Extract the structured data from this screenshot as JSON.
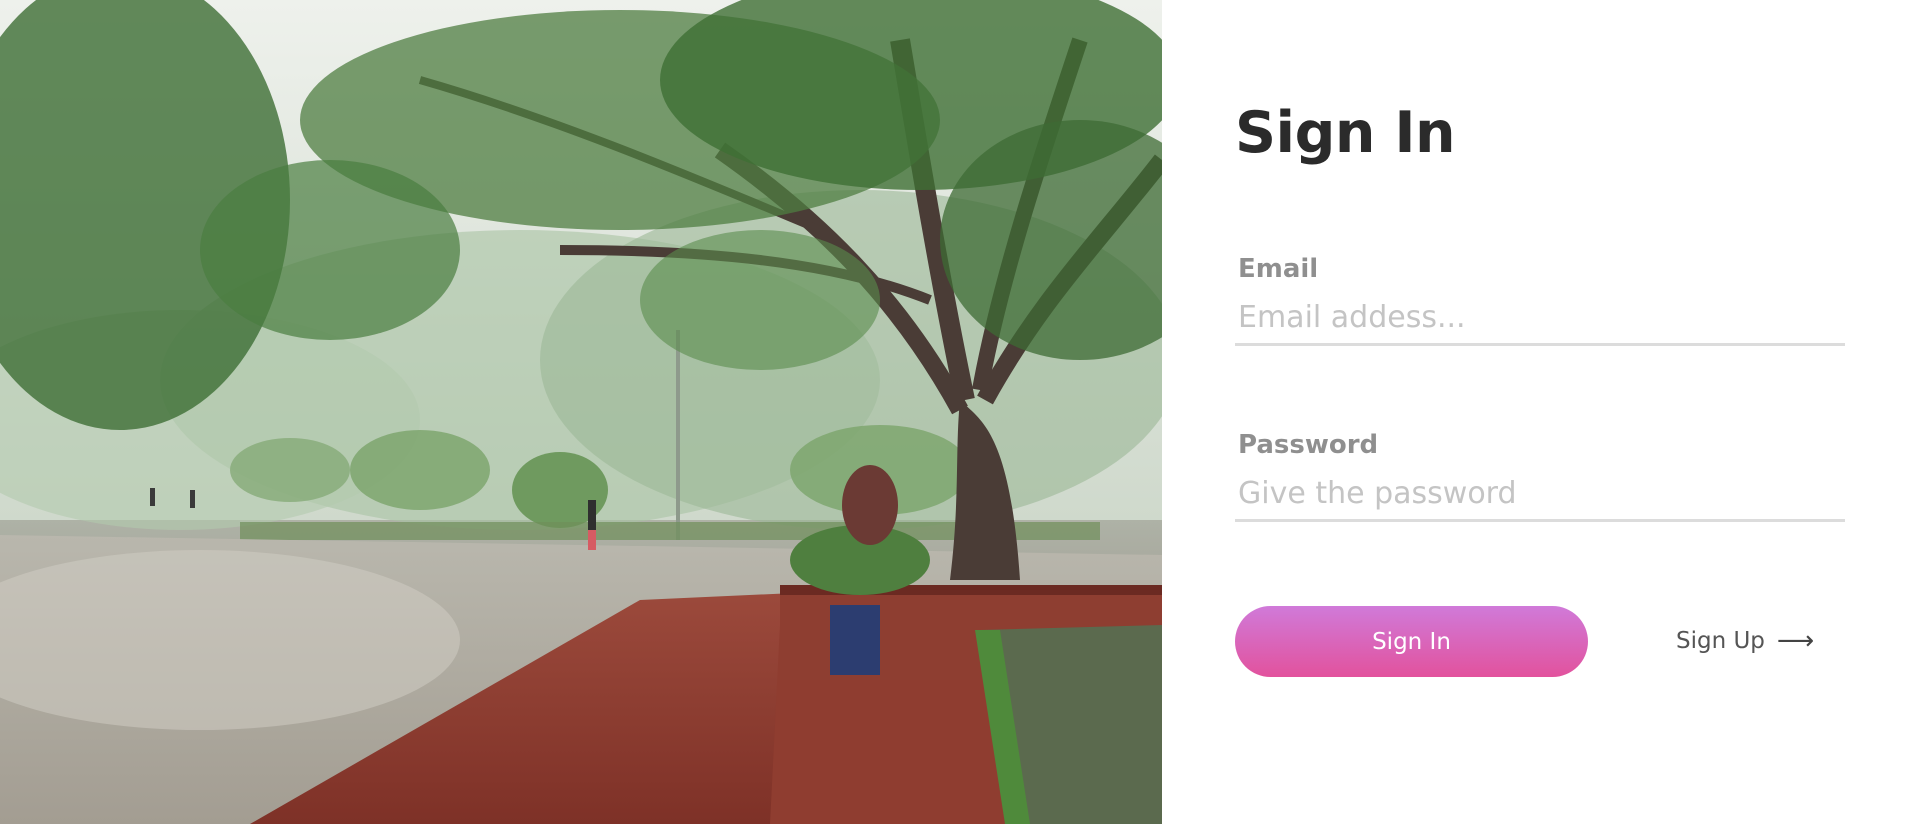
{
  "form": {
    "title": "Sign In",
    "email": {
      "label": "Email",
      "placeholder": "Email addess...",
      "value": ""
    },
    "password": {
      "label": "Password",
      "placeholder": "Give the password",
      "value": ""
    },
    "signin_label": "Sign In",
    "signup_label": "Sign Up",
    "signup_icon": "arrow-right-icon"
  },
  "colors": {
    "button_gradient_top": "#d07ad9",
    "button_gradient_bottom": "#e2529d",
    "title": "#2b2b2b",
    "label": "#8f8f8f",
    "placeholder": "#c4c4c4",
    "underline": "#dcdcdc"
  }
}
